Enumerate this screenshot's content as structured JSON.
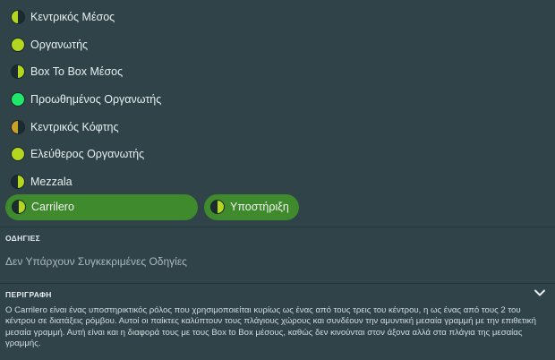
{
  "roles": [
    {
      "label": "Κεντρικός Μέσος",
      "left": "#b5d61e",
      "right": "#1c2b2f"
    },
    {
      "label": "Οργανωτής",
      "left": "#b5d61e",
      "right": "#b5d61e"
    },
    {
      "label": "Box To Box Μέσος",
      "left": "#1c2b2f",
      "right": "#b5d61e"
    },
    {
      "label": "Προωθημένος Οργανωτής",
      "left": "#1ee86a",
      "right": "#1ee86a"
    },
    {
      "label": "Κεντρικός Κόφτης",
      "left": "#c9a028",
      "right": "#1c2b2f"
    },
    {
      "label": "Ελεύθερος Οργανωτής",
      "left": "#b5d61e",
      "right": "#b5d61e"
    },
    {
      "label": "Mezzala",
      "left": "#1c2b2f",
      "right": "#b5d61e"
    }
  ],
  "selected": {
    "role": {
      "label": "Carrilero",
      "left": "#1c2b2f",
      "right": "#b5d61e"
    },
    "duty": {
      "label": "Υποστήριξη",
      "left": "#1c2b2f",
      "right": "#b5d61e"
    }
  },
  "instructions": {
    "heading": "ΟΔΗΓΙΕΣ",
    "text": "Δεν Υπάρχουν Συγκεκριμένες Οδηγίες"
  },
  "description": {
    "heading": "ΠΕΡΙΓΡΑΦΗ",
    "text": "Ο Carrilero είναι ένας υποστηρικτικός ρόλος που χρησιμοποιείται κυρίως ως ένας από τους τρεις του κέντρου, η ως ένας από τους 2 του κέντρου σε διατάξεις ρόμβου. Αυτοί οι παίκτες καλύπτουν τους πλάγιους χώρους και συνδέουν την αμυντική μεσαία γραμμή με την επιθετική μεσαία γραμμή. Αυτή είναι και η διαφορά τους με τους Box to Box μέσους, καθώς δεν κινούνται στον άξονα αλλά στα πλάγια της μεσαίας γραμμής."
  }
}
